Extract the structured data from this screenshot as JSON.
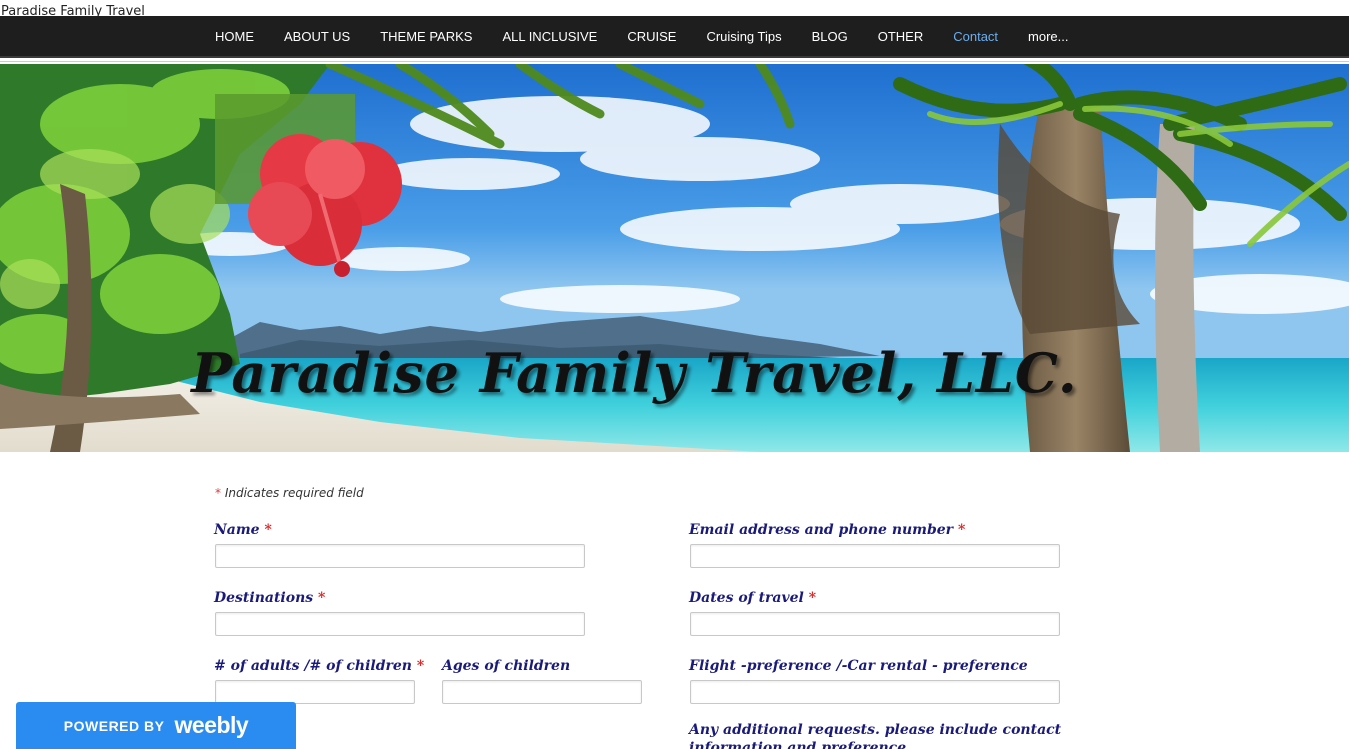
{
  "site": {
    "title_text": "Paradise Family Travel"
  },
  "nav": {
    "items": [
      {
        "label": "HOME",
        "name": "home"
      },
      {
        "label": "ABOUT US",
        "name": "about-us"
      },
      {
        "label": "THEME PARKS",
        "name": "theme-parks"
      },
      {
        "label": "ALL INCLUSIVE",
        "name": "all-inclusive"
      },
      {
        "label": "CRUISE",
        "name": "cruise"
      },
      {
        "label": "Cruising Tips",
        "name": "cruising-tips"
      },
      {
        "label": "BLOG",
        "name": "blog"
      },
      {
        "label": "OTHER",
        "name": "other"
      },
      {
        "label": "Contact",
        "name": "contact",
        "active": true
      },
      {
        "label": "more...",
        "name": "more"
      }
    ],
    "active_color": "#6aaef0",
    "bg_color": "#1e1e1e"
  },
  "banner": {
    "headline": "Paradise Family Travel, LLC."
  },
  "form": {
    "required_note": "Indicates required field",
    "required_mark": "*",
    "fields": {
      "name": {
        "label": "Name",
        "required": true,
        "value": ""
      },
      "email": {
        "label": "Email address and phone number",
        "required": true,
        "value": ""
      },
      "destinations": {
        "label": "Destinations",
        "required": true,
        "value": ""
      },
      "dates": {
        "label": "Dates of travel",
        "required": true,
        "value": ""
      },
      "adults": {
        "label": "# of adults /# of children",
        "required": true,
        "value": ""
      },
      "ages": {
        "label": "Ages of children",
        "required": false,
        "value": ""
      },
      "flight": {
        "label": "Flight -preference /-Car rental - preference",
        "required": false,
        "value": ""
      },
      "additional": {
        "label": "Any additional requests. please include contact information and preference",
        "required": false
      }
    },
    "label_color": "#1a1a7a"
  },
  "badge": {
    "powered_by": "POWERED BY",
    "brand": "weebly",
    "color": "#2a8cf0"
  }
}
